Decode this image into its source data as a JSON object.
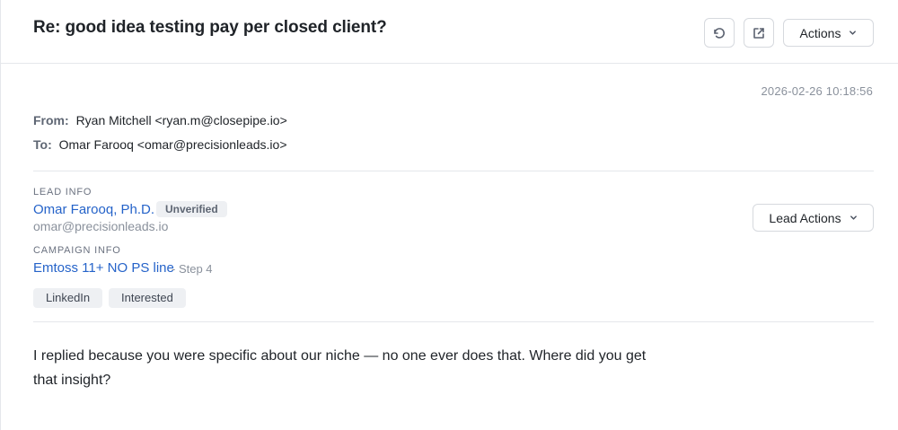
{
  "email": {
    "subject": "Re: good idea testing pay per closed client?",
    "timestamp": "2026-02-26 10:18:56",
    "from_label": "From:",
    "from_value": "Ryan Mitchell <ryan.m@closepipe.io>",
    "to_label": "To:",
    "to_value": "Omar Farooq <omar@precisionleads.io>",
    "body": "I replied because you were specific about our niche — no one ever does that. Where did you get that insight?"
  },
  "toolbar": {
    "reload_icon": "refresh-icon",
    "open_icon": "external-link-icon",
    "actions_label": "Actions"
  },
  "lead": {
    "section_label": "LEAD INFO",
    "name": "Omar Farooq, Ph.D.",
    "status_badge": "Unverified",
    "email": "omar@precisionleads.io",
    "actions_label": "Lead Actions"
  },
  "campaign": {
    "section_label": "CAMPAIGN INFO",
    "name": "Emtoss 11+ NO PS line",
    "step": "- Step 4"
  },
  "tags": [
    "LinkedIn",
    "Interested"
  ],
  "colors": {
    "link": "#2563c9",
    "muted": "#8a919c",
    "badge_bg": "#eef0f3",
    "border": "#d6d9de"
  }
}
